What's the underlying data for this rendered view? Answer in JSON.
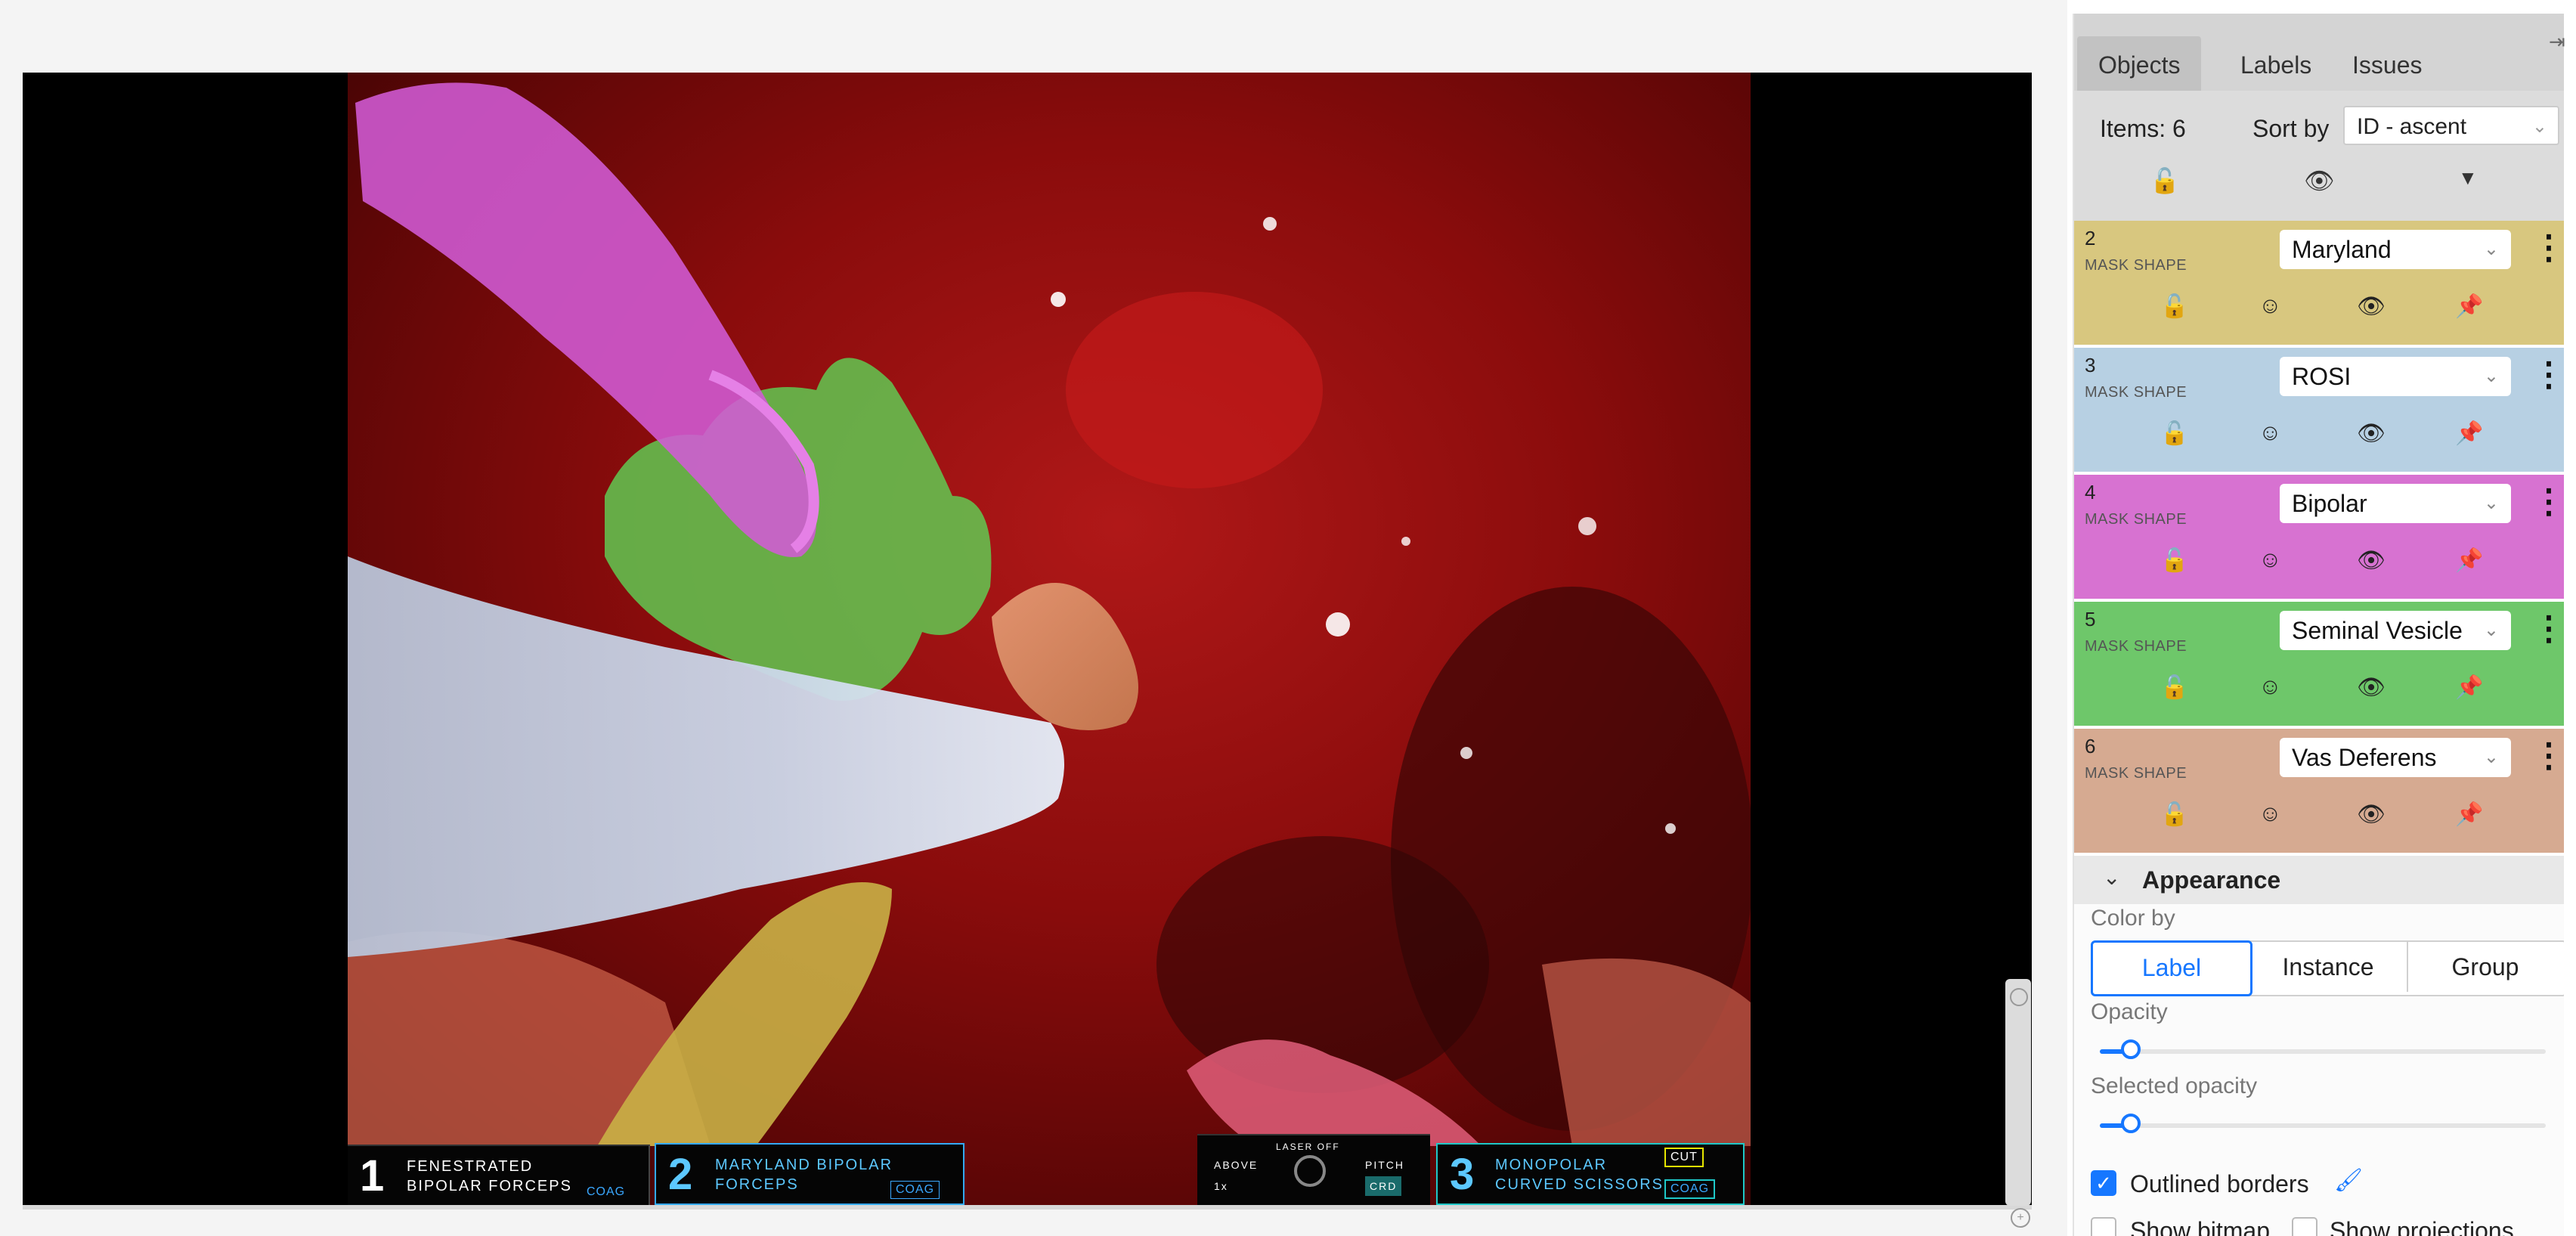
{
  "hud": {
    "arm1": {
      "num": "1",
      "line1": "FENESTRATED",
      "line2": "BIPOLAR FORCEPS",
      "tag": "COAG"
    },
    "arm2": {
      "num": "2",
      "line1": "MARYLAND BIPOLAR",
      "line2": "FORCEPS",
      "tag": "COAG"
    },
    "center": {
      "top": "LASER OFF",
      "above": "ABOVE",
      "zoom": "1x",
      "pitch": "PITCH",
      "crd": "CRD"
    },
    "arm3": {
      "num": "3",
      "line1": "MONOPOLAR",
      "line2": "CURVED SCISSORS",
      "cut": "CUT",
      "coag": "COAG"
    }
  },
  "panel": {
    "tabs": [
      {
        "label": "Objects"
      },
      {
        "label": "Labels"
      },
      {
        "label": "Issues"
      }
    ],
    "items_count": "Items: 6",
    "sort_label": "Sort by",
    "sort_value": "ID - ascent",
    "objects": [
      {
        "id": "2",
        "type": "MASK SHAPE",
        "label": "Maryland",
        "color": "#d8c77f"
      },
      {
        "id": "3",
        "type": "MASK SHAPE",
        "label": "ROSI",
        "color": "#b7d0e3"
      },
      {
        "id": "4",
        "type": "MASK SHAPE",
        "label": "Bipolar",
        "color": "#d772d1"
      },
      {
        "id": "5",
        "type": "MASK SHAPE",
        "label": "Seminal Vesicle",
        "color": "#6ec76a"
      },
      {
        "id": "6",
        "type": "MASK SHAPE",
        "label": "Vas Deferens",
        "color": "#d6aa91"
      }
    ],
    "appearance": {
      "title": "Appearance",
      "color_by_label": "Color by",
      "color_by_options": [
        {
          "label": "Label"
        },
        {
          "label": "Instance"
        },
        {
          "label": "Group"
        }
      ],
      "opacity_label": "Opacity",
      "opacity_value": 0.07,
      "selected_opacity_label": "Selected opacity",
      "selected_opacity_value": 0.07,
      "outlined_borders": "Outlined borders",
      "show_bitmap": "Show bitmap",
      "show_projections": "Show projections"
    }
  },
  "colors": {
    "accent": "#1677ff"
  }
}
